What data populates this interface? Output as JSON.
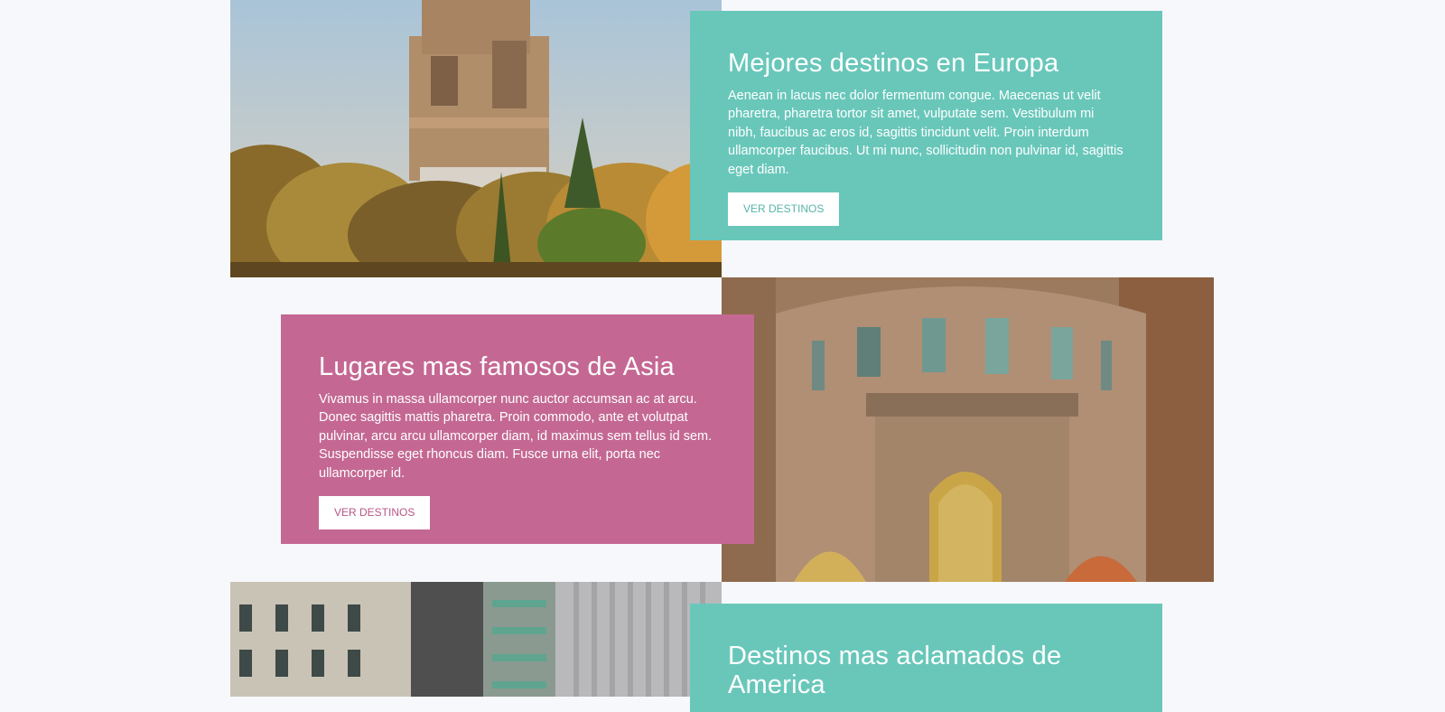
{
  "colors": {
    "teal": "#69c7ba",
    "pink": "#c46893",
    "background": "#f7f8fb"
  },
  "sections": [
    {
      "title": "Mejores destinos en Europa",
      "text": "Aenean in lacus nec dolor fermentum congue. Maecenas ut velit pharetra, pharetra tortor sit amet, vulputate sem. Vestibulum mi nibh, faucibus ac eros id, sagittis tincidunt velit. Proin interdum ullamcorper faucibus. Ut mi nunc, sollicitudin non pulvinar id, sagittis eget diam.",
      "button": "VER DESTINOS",
      "image": "monument-on-hill-photo"
    },
    {
      "title": "Lugares mas famosos de Asia",
      "text": "Vivamus in massa ullamcorper nunc auctor accumsan ac at arcu. Donec sagittis mattis pharetra. Proin commodo, ante et volutpat pulvinar, arcu arcu ullamcorper diam, id maximus sem tellus id sem. Suspendisse eget rhoncus diam. Fusce urna elit, porta nec ullamcorper id.",
      "button": "VER DESTINOS",
      "image": "stone-building-mosaic-photo"
    },
    {
      "title": "Destinos mas aclamados de America",
      "image": "city-buildings-photo"
    }
  ]
}
